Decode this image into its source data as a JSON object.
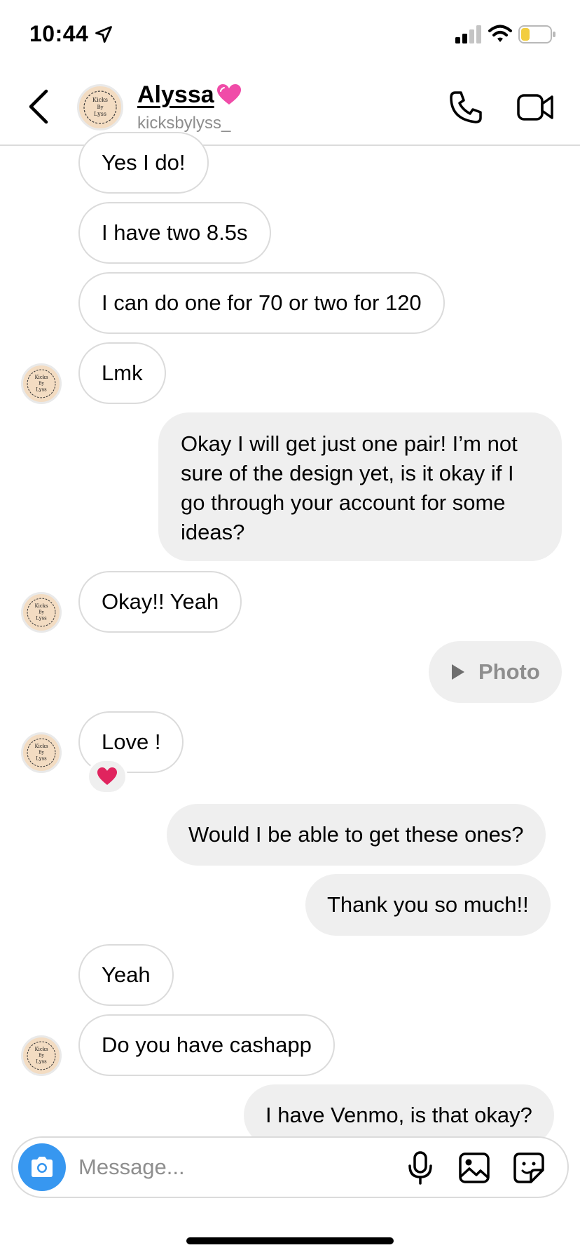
{
  "status_bar": {
    "time": "10:44"
  },
  "header": {
    "name": "Alyssa",
    "handle": "kicksbylyss_",
    "avatar_logo": "Kicks By Lyss"
  },
  "messages": [
    {
      "text": "Yes I do!",
      "direction": "incoming"
    },
    {
      "text": "I have two 8.5s",
      "direction": "incoming"
    },
    {
      "text": "I can do one for 70 or two for 120",
      "direction": "incoming"
    },
    {
      "text": "Lmk",
      "direction": "incoming"
    },
    {
      "text": "Okay I will get just one pair! I’m not sure of the design yet, is it okay if I go through your account for some ideas?",
      "direction": "outgoing"
    },
    {
      "text": "Okay!! Yeah",
      "direction": "incoming"
    },
    {
      "text": "Photo",
      "direction": "outgoing",
      "icon": "play-icon"
    },
    {
      "text": "Love !",
      "direction": "incoming",
      "reaction": "heart-icon"
    },
    {
      "text": "Would I be able to get these ones?",
      "direction": "outgoing"
    },
    {
      "text": "Thank you so much!!",
      "direction": "outgoing"
    },
    {
      "text": "Yeah",
      "direction": "incoming"
    },
    {
      "text": "Do you have cashapp",
      "direction": "incoming"
    },
    {
      "text": "I have Venmo, is that okay?",
      "direction": "outgoing"
    }
  ],
  "composer": {
    "placeholder": "Message..."
  },
  "colors": {
    "accent": "#3797f0",
    "outgoing_bubble": "#efefef",
    "incoming_border": "#dbdbdb",
    "muted_text": "#8e8e8e",
    "heart": "#e0245e"
  }
}
